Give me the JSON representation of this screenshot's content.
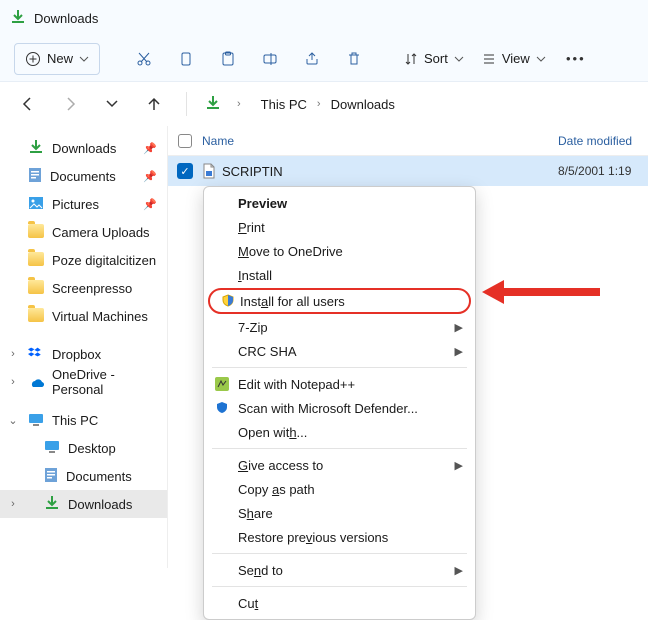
{
  "title": "Downloads",
  "toolbar": {
    "new_label": "New",
    "sort_label": "Sort",
    "view_label": "View"
  },
  "breadcrumb": {
    "items": [
      "This PC",
      "Downloads"
    ]
  },
  "sidebar": {
    "quick": [
      {
        "name": "Downloads",
        "pinned": true,
        "icon": "download"
      },
      {
        "name": "Documents",
        "pinned": true,
        "icon": "doc"
      },
      {
        "name": "Pictures",
        "pinned": true,
        "icon": "pic"
      },
      {
        "name": "Camera Uploads",
        "pinned": false,
        "icon": "folder"
      },
      {
        "name": "Poze digitalcitizen",
        "pinned": false,
        "icon": "folder"
      },
      {
        "name": "Screenpresso",
        "pinned": false,
        "icon": "folder"
      },
      {
        "name": "Virtual Machines",
        "pinned": false,
        "icon": "folder"
      }
    ],
    "roots": [
      {
        "name": "Dropbox",
        "expander": "›",
        "icon": "dropbox"
      },
      {
        "name": "OneDrive - Personal",
        "expander": "›",
        "icon": "onedrive"
      }
    ],
    "thispc": {
      "label": "This PC",
      "items": [
        {
          "name": "Desktop",
          "icon": "desktop"
        },
        {
          "name": "Documents",
          "icon": "doc"
        },
        {
          "name": "Downloads",
          "icon": "download",
          "selected": true
        }
      ]
    }
  },
  "columns": {
    "name": "Name",
    "date": "Date modified"
  },
  "file": {
    "name": "SCRIPTIN",
    "date": "8/5/2001 1:19"
  },
  "context_menu": {
    "items": [
      {
        "label": "Preview",
        "bold": true
      },
      {
        "label": "Print",
        "accel": "P"
      },
      {
        "label": "Move to OneDrive",
        "accel": "M"
      },
      {
        "label": "Install",
        "accel": "I"
      },
      {
        "label": "Install for all users",
        "accel": "a",
        "icon": "shield",
        "highlight": true
      },
      {
        "label": "7-Zip",
        "submenu": true
      },
      {
        "label": "CRC SHA",
        "submenu": true
      },
      {
        "sep": true
      },
      {
        "label": "Edit with Notepad++",
        "icon": "npp"
      },
      {
        "label": "Scan with Microsoft Defender...",
        "icon": "defender"
      },
      {
        "label": "Open with...",
        "accel": "h"
      },
      {
        "sep": true
      },
      {
        "label": "Give access to",
        "accel": "G",
        "submenu": true
      },
      {
        "label": "Copy as path",
        "accel": "a2"
      },
      {
        "label": "Share",
        "accel": "h2"
      },
      {
        "label": "Restore previous versions",
        "accel": "v"
      },
      {
        "sep": true
      },
      {
        "label": "Send to",
        "accel": "n",
        "submenu": true
      },
      {
        "sep": true
      },
      {
        "label": "Cut",
        "accel": "t"
      }
    ]
  }
}
